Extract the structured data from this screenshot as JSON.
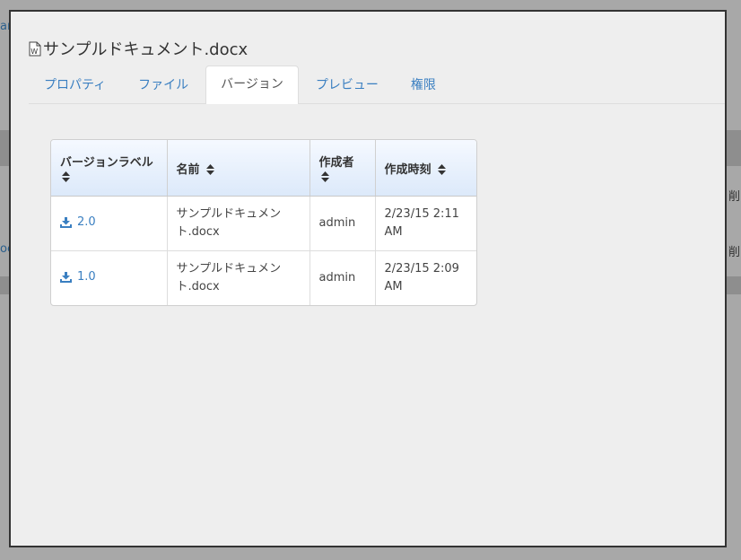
{
  "background": {
    "edge_texts": [
      "ar",
      "oc",
      "削",
      "削"
    ]
  },
  "modal": {
    "title": "サンプルドキュメント.docx",
    "tabs": [
      {
        "label": "プロパティ",
        "active": false
      },
      {
        "label": "ファイル",
        "active": false
      },
      {
        "label": "バージョン",
        "active": true
      },
      {
        "label": "プレビュー",
        "active": false
      },
      {
        "label": "権限",
        "active": false
      }
    ],
    "table": {
      "headers": [
        "バージョンラベル",
        "名前",
        "作成者",
        "作成時刻"
      ],
      "rows": [
        {
          "version": "2.0",
          "name": "サンプルドキュメント.docx",
          "author": "admin",
          "created": "2/23/15 2:11 AM"
        },
        {
          "version": "1.0",
          "name": "サンプルドキュメント.docx",
          "author": "admin",
          "created": "2/23/15 2:09 AM"
        }
      ]
    }
  },
  "colors": {
    "link": "#3a7fc1",
    "header_gradient_top": "#f5f9ff",
    "header_gradient_bottom": "#dce9fa",
    "modal_bg": "#eeeeee"
  },
  "icons": {
    "title": "word-document-icon",
    "sort": "sort-icon",
    "download": "download-icon"
  }
}
